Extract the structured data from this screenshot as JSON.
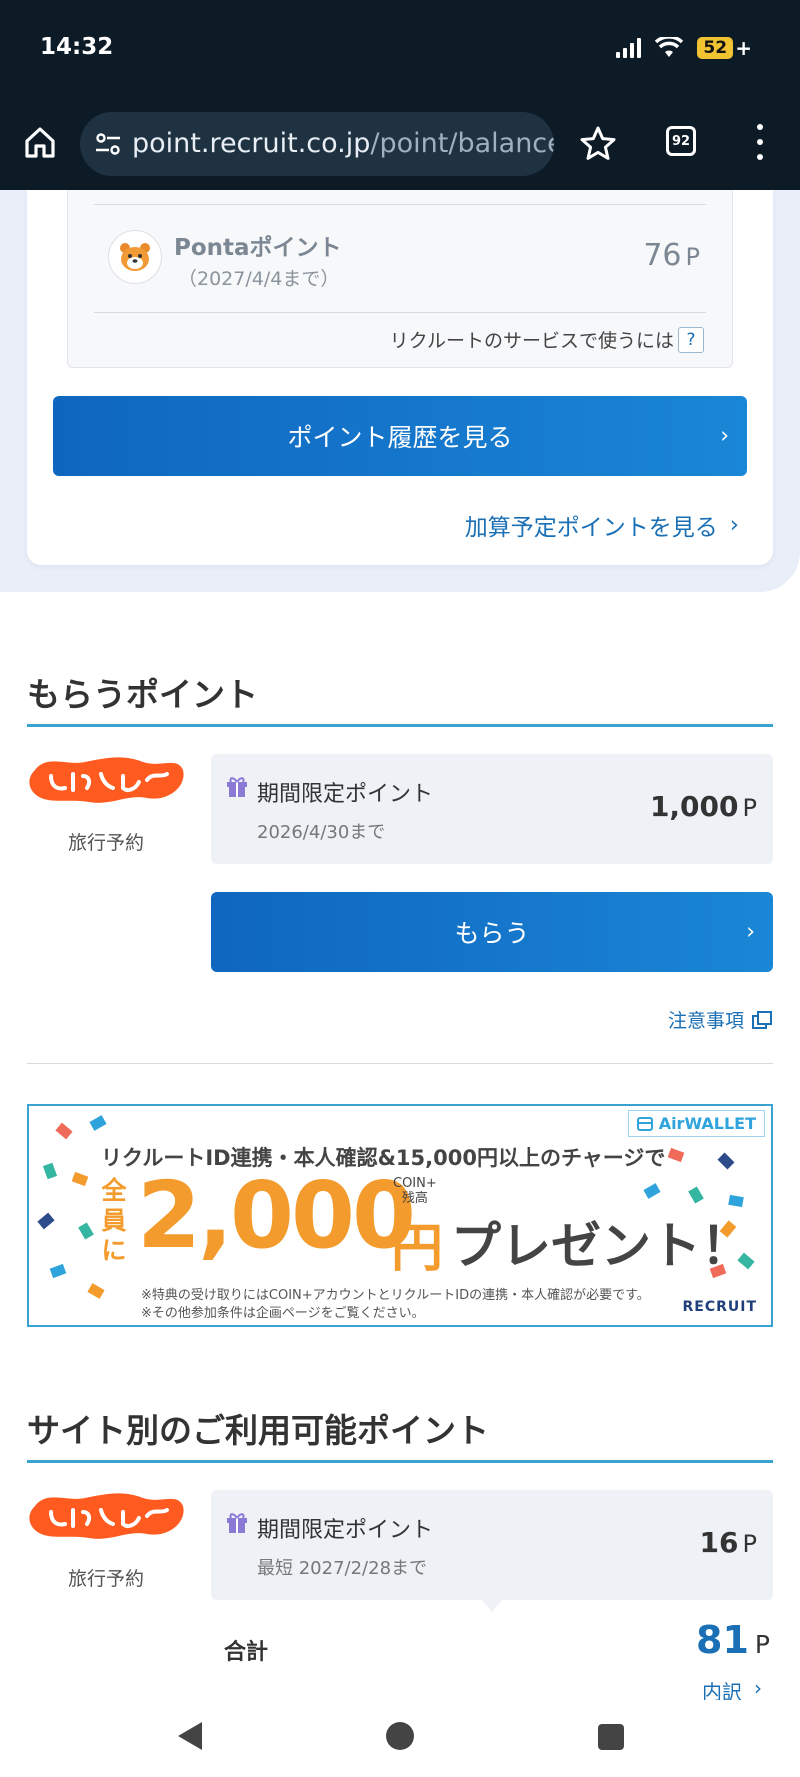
{
  "status_bar": {
    "time": "14:32",
    "battery": "52"
  },
  "browser": {
    "url_domain": "point.recruit.co.jp",
    "url_path": "/point/balanceRe",
    "tab_count": "92"
  },
  "ponta": {
    "name": "Pontaポイント",
    "expiry": "（2027/4/4まで）",
    "value": "76",
    "unit": "P",
    "help_text": "リクルートのサービスで使うには",
    "help_badge": "?"
  },
  "history_button": "ポイント履歴を見る",
  "scheduled_link": "加算予定ポイントを見る",
  "receive": {
    "title": "もらうポイント",
    "service_caption": "旅行予約",
    "point_label": "期間限定ポイント",
    "expiry": "2026/4/30まで",
    "value": "1,000",
    "unit": "P",
    "button": "もらう",
    "notice": "注意事項"
  },
  "banner": {
    "brand": "AirWALLET",
    "headline": "リクルートID連携・本人確認&15,000円以上のチャージで",
    "everyone": "全員に",
    "amount": "2,000",
    "coin_label_1": "COIN+",
    "coin_label_2": "残高",
    "yen": "円",
    "present": "プレゼント！",
    "note_1": "※特典の受け取りにはCOIN+アカウントとリクルートIDの連携・本人確認が必要です。",
    "note_2": "※その他参加条件は企画ページをご覧ください。",
    "recruit": "RECRUIT"
  },
  "available": {
    "title": "サイト別のご利用可能ポイント",
    "service_caption": "旅行予約",
    "point_label": "期間限定ポイント",
    "expiry": "最短 2027/2/28まで",
    "value": "16",
    "unit": "P",
    "total_label": "合計",
    "total_value": "81",
    "total_unit": "P",
    "breakdown": "内訳"
  },
  "colors": {
    "accent": "#1a6fb5",
    "rule": "#3aa2d0",
    "jalan": "#ff5a1f",
    "banner_orange": "#f39b2d"
  }
}
